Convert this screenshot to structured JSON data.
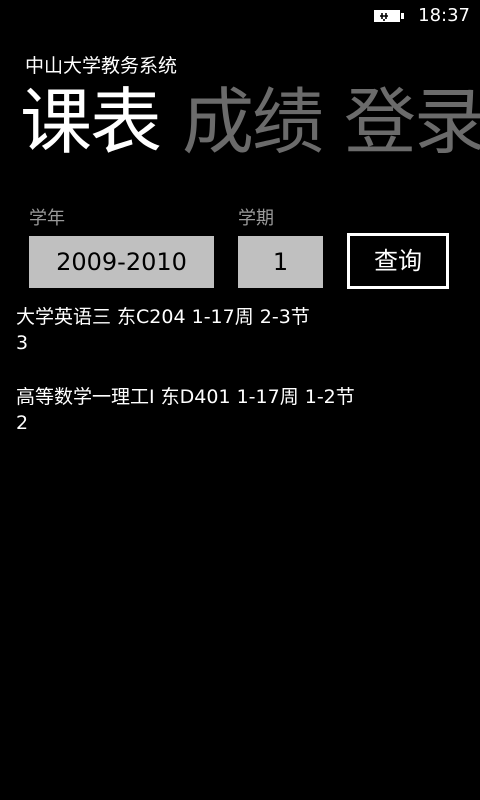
{
  "status_bar": {
    "battery_icon": "battery-charging-icon",
    "time": "18:37"
  },
  "app": {
    "title": "中山大学教务系统"
  },
  "pivot": {
    "items": [
      {
        "label": "课表",
        "active": true
      },
      {
        "label": "成绩",
        "active": false
      },
      {
        "label": "登录",
        "active": false
      }
    ]
  },
  "filters": {
    "year_label": "学年",
    "year_value": "2009-2010",
    "term_label": "学期",
    "term_value": "1",
    "query_label": "查询"
  },
  "courses": [
    {
      "summary": "大学英语三 东C204 1-17周 2-3节",
      "day": "3"
    },
    {
      "summary": "高等数学一理工Ⅰ 东D401 1-17周 1-2节",
      "day": "2"
    }
  ]
}
